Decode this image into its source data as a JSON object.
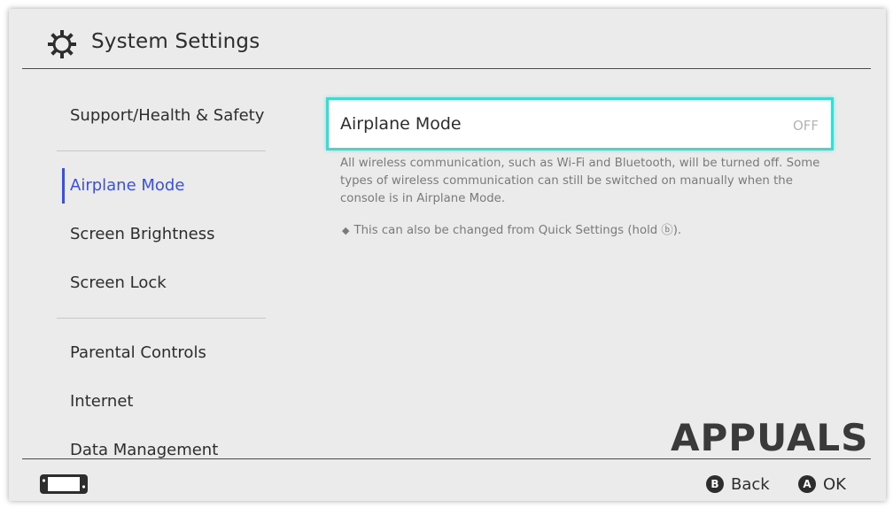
{
  "header": {
    "title": "System Settings",
    "icon": "gear-icon"
  },
  "sidebar": {
    "items": [
      {
        "label": "Support/Health & Safety",
        "active": false
      },
      {
        "label": "Airplane Mode",
        "active": true
      },
      {
        "label": "Screen Brightness",
        "active": false
      },
      {
        "label": "Screen Lock",
        "active": false
      },
      {
        "label": "Parental Controls",
        "active": false
      },
      {
        "label": "Internet",
        "active": false
      },
      {
        "label": "Data Management",
        "active": false
      }
    ]
  },
  "main": {
    "setting": {
      "label": "Airplane Mode",
      "value": "OFF"
    },
    "description": "All wireless communication, such as Wi-Fi and Bluetooth, will be turned off. Some types of wireless communication can still be switched on manually when the console is in Airplane Mode.",
    "note": "This can also be changed from Quick Settings (hold ⓑ)."
  },
  "footer": {
    "back": {
      "button": "B",
      "label": "Back"
    },
    "ok": {
      "button": "A",
      "label": "OK"
    }
  },
  "watermark": {
    "text": "APPUALS"
  },
  "colors": {
    "accent": "#3c50dc",
    "selection": "#3fd9d0",
    "background": "#ebebeb"
  }
}
